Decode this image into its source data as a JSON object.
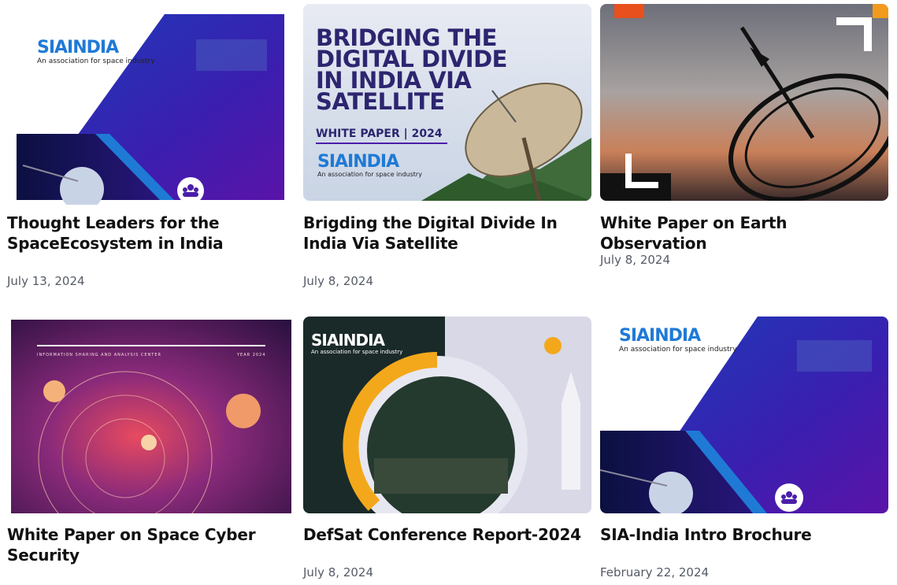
{
  "cards": [
    {
      "title": "Thought Leaders for the SpaceEcosystem in India",
      "date": "July 13, 2024",
      "thumb": {
        "logo": "SIAINDIA",
        "tagline": "An association for space industry"
      }
    },
    {
      "title": "Brigding the Digital Divide In India Via Satellite",
      "date": "July 8, 2024",
      "thumb": {
        "headline_1": "BRIDGING THE",
        "headline_2": "DIGITAL DIVIDE",
        "headline_3": "IN INDIA VIA",
        "headline_4": "SATELLITE",
        "subtitle": "WHITE PAPER | 2024",
        "logo": "SIAINDIA",
        "tagline": "An association for space industry"
      }
    },
    {
      "title": "White Paper on Earth Observation",
      "date": "July 8, 2024",
      "thumb": {}
    },
    {
      "title": "White Paper on Space Cyber Security",
      "date": "",
      "thumb": {
        "caption_left": "INFORMATION SHARING AND ANALYSIS CENTER",
        "caption_right": "YEAR 2024"
      }
    },
    {
      "title": "DefSat Conference Report-2024",
      "date": "July 8, 2024",
      "thumb": {
        "logo": "SIAINDIA",
        "tagline": "An association for space industry"
      }
    },
    {
      "title": "SIA-India Intro Brochure",
      "date": "February 22, 2024",
      "thumb": {
        "logo": "SIAINDIA",
        "tagline": "An association for space industry"
      }
    }
  ],
  "icons": {
    "group": "group-people-icon"
  },
  "colors": {
    "brand_purple": "#4a1fa8",
    "brand_blue": "#1f7ad6",
    "text": "#111111",
    "date": "#555b66"
  }
}
